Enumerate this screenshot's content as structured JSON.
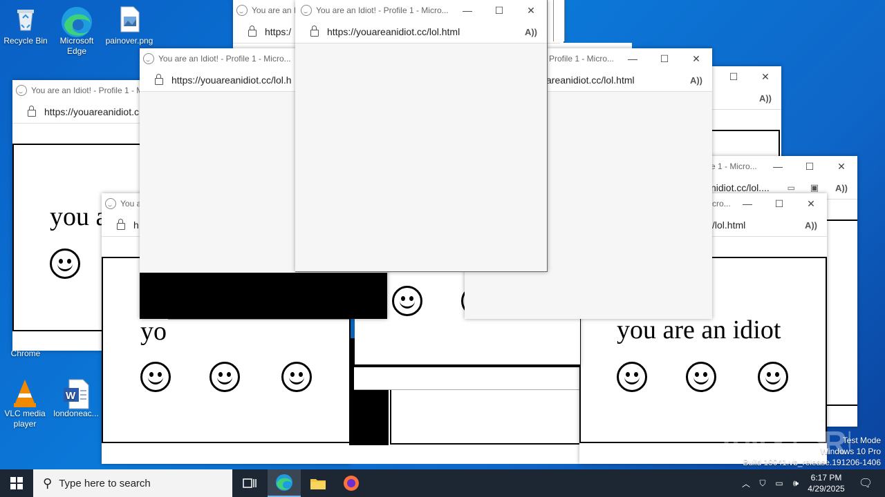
{
  "desktop": {
    "icons": [
      {
        "label": "Recycle Bin",
        "icon": "recycle-bin-icon"
      },
      {
        "label": "Microsoft Edge",
        "icon": "edge-icon"
      },
      {
        "label": "painover.png",
        "icon": "image-file-icon"
      },
      {
        "label": "Chrome",
        "icon": "chrome-icon"
      },
      {
        "label": "VLC media player",
        "icon": "vlc-icon"
      },
      {
        "label": "londoneac...",
        "icon": "word-doc-icon"
      }
    ]
  },
  "browser": {
    "title": "You are an Idiot! - Profile 1 - Micro...",
    "title_short": "You are an Idiot! - Profile 1 - M",
    "title_stub1": "You are an Id",
    "title_stub2": "You a",
    "title_tail1": "Profile 1 - Micro...",
    "title_tail2": "e 1 - Micro...",
    "title_tail3": "cro...",
    "url": "https://youareanidiot.cc/lol.html",
    "url_a": "https://youareanidiot.c",
    "url_b": "https://youareanidiot.cc/lol.h",
    "url_c": "areanidiot.cc/lol.html",
    "url_d": "nidiot.cc/lol....",
    "url_e": "/lol.html",
    "url_f": "https:/",
    "url_g": "h",
    "page_text": "you are an idiot",
    "page_text_cut1": "you a",
    "page_text_cut2": "yo"
  },
  "taskbar": {
    "search_placeholder": "Type here to search",
    "time": "6:17 PM",
    "date": "4/29/2025"
  },
  "watermark": {
    "line1": "Test Mode",
    "line2": "Windows 10 Pro",
    "line3": "Build 19041.vb_release.191206-1406"
  },
  "colors": {
    "accent": "#0b78d8",
    "taskbar": "#1c2733"
  }
}
